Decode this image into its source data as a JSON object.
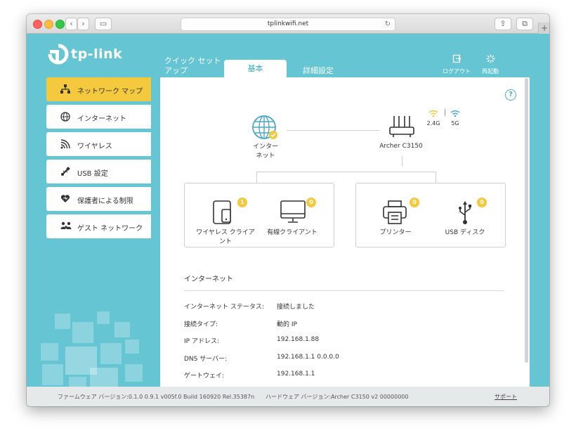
{
  "browser": {
    "url": "tplinkwifi.net",
    "nav_back": "‹",
    "nav_forward": "›",
    "sidebar_toggle": "▭",
    "reload": "↻",
    "share": "⇪",
    "tabs_overview": "⧉",
    "new_tab": "+"
  },
  "brand": {
    "logo_text": "tp-link"
  },
  "top_tabs": {
    "quick_setup": "クイック セット\nアップ",
    "basic": "基本",
    "advanced": "詳細設定"
  },
  "tools": {
    "logout": "ログアウト",
    "reboot": "再起動"
  },
  "sidebar": {
    "items": [
      {
        "label": "ネットワーク マップ",
        "icon": "network-map-icon",
        "active": true
      },
      {
        "label": "インターネット",
        "icon": "globe-icon",
        "active": false
      },
      {
        "label": "ワイヤレス",
        "icon": "wifi-icon",
        "active": false
      },
      {
        "label": "USB 設定",
        "icon": "usb-icon",
        "active": false
      },
      {
        "label": "保護者による制限",
        "icon": "heart-icon",
        "active": false
      },
      {
        "label": "ゲスト ネットワーク",
        "icon": "guest-icon",
        "active": false
      }
    ]
  },
  "map": {
    "help": "?",
    "internet_label": "インター\nネット",
    "router_label": "Archer C3150",
    "band_24": "2.4G",
    "band_5": "5G",
    "devices_left": [
      {
        "label": "ワイヤレス クライア\nント",
        "count": "1",
        "icon": "tablet-icon"
      },
      {
        "label": "有線クライアント",
        "count": "0",
        "icon": "monitor-icon"
      }
    ],
    "devices_right": [
      {
        "label": "プリンター",
        "count": "0",
        "icon": "printer-icon"
      },
      {
        "label": "USB ディスク",
        "count": "0",
        "icon": "usb-disk-icon"
      }
    ]
  },
  "internet_section": {
    "title": "インターネット",
    "rows": [
      {
        "key": "インターネット ステータス:",
        "value": "接続しました"
      },
      {
        "key": "接続タイプ:",
        "value": "動的 IP"
      },
      {
        "key": "IP アドレス:",
        "value": "192.168.1.88"
      },
      {
        "key": "DNS サーバー:",
        "value": "192.168.1.1 0.0.0.0"
      },
      {
        "key": "ゲートウェイ:",
        "value": "192.168.1.1"
      }
    ]
  },
  "footer": {
    "firmware": "ファームウェア バージョン:0.1.0 0.9.1 v005f.0 Build 160920 Rel.35387n",
    "hardware": "ハードウェア バージョン:Archer C3150 v2 00000000",
    "support": "サポート"
  },
  "colors": {
    "teal": "#65c5d3",
    "accent": "#f4c93e",
    "icon_blue": "#4aa9c6"
  }
}
